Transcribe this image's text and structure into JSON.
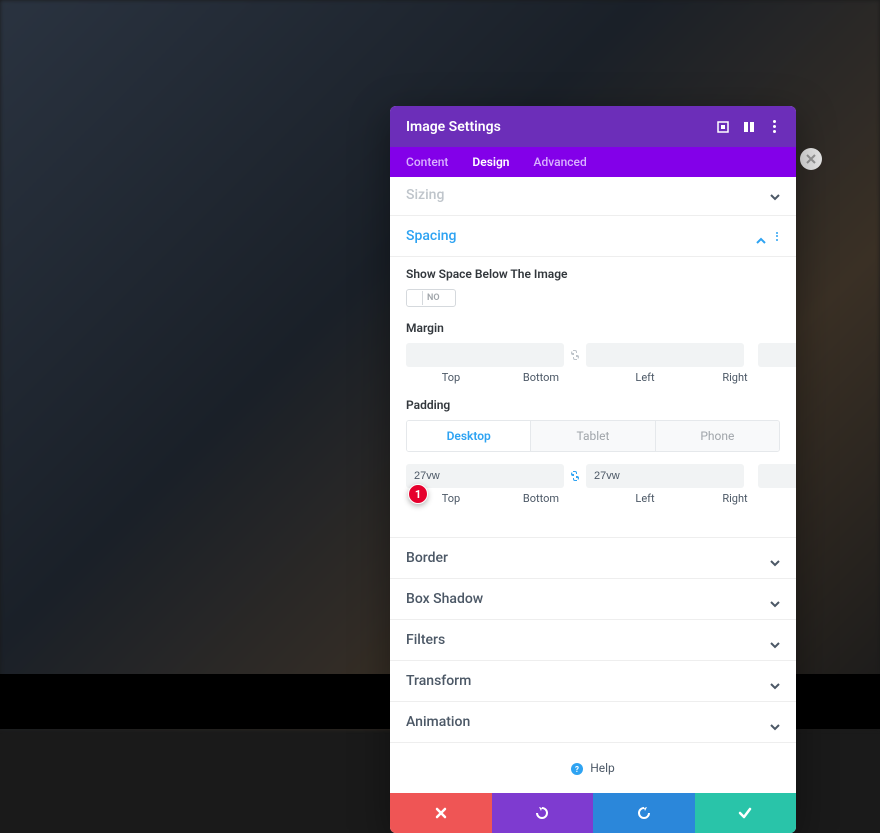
{
  "panel": {
    "title": "Image Settings"
  },
  "tabs": {
    "content": "Content",
    "design": "Design",
    "advanced": "Advanced"
  },
  "sections": {
    "sizing": "Sizing",
    "spacing": "Spacing",
    "border": "Border",
    "box_shadow": "Box Shadow",
    "filters": "Filters",
    "transform": "Transform",
    "animation": "Animation"
  },
  "spacing": {
    "show_space_label": "Show Space Below The Image",
    "show_space_value": "NO",
    "margin_label": "Margin",
    "margin": {
      "top": "",
      "bottom": "",
      "left": "",
      "right": ""
    },
    "padding_label": "Padding",
    "devices": {
      "desktop": "Desktop",
      "tablet": "Tablet",
      "phone": "Phone"
    },
    "padding": {
      "top": "27vw",
      "bottom": "27vw",
      "left": "",
      "right": ""
    },
    "sides": {
      "top": "Top",
      "bottom": "Bottom",
      "left": "Left",
      "right": "Right"
    }
  },
  "help": "Help",
  "annotation": "1"
}
